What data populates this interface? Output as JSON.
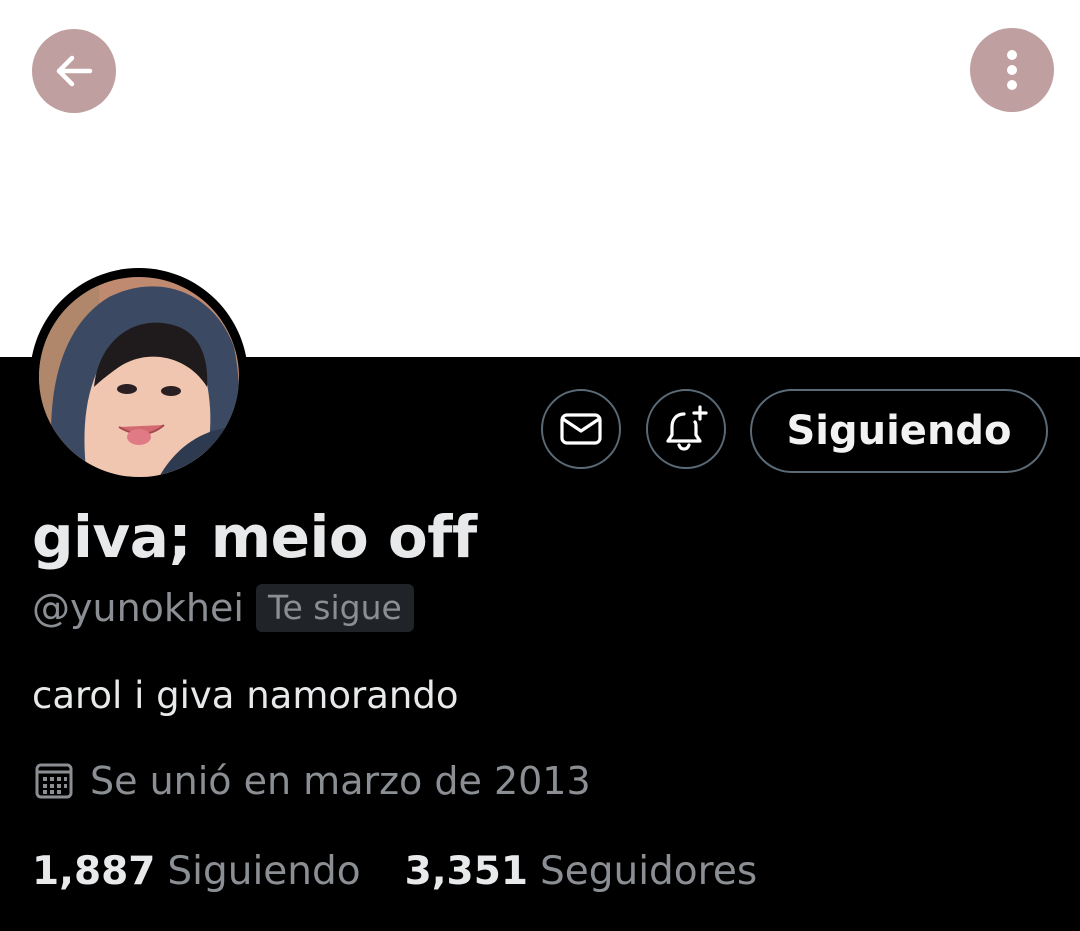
{
  "header": {
    "back_icon": "arrow-left-icon",
    "more_icon": "more-vertical-icon",
    "button_color": "#bf9f9f",
    "banner_color": "#ffffff"
  },
  "profile": {
    "display_name": "giva; meio off",
    "handle": "@yunokhei",
    "follows_you_badge": "Te sigue",
    "bio": "carol i giva namorando",
    "joined": "Se unió en marzo de 2013",
    "joined_icon": "calendar-icon"
  },
  "actions": {
    "message_icon": "envelope-icon",
    "notify_icon": "bell-plus-icon",
    "follow_button_label": "Siguiendo"
  },
  "stats": {
    "following_count": "1,887",
    "following_label": "Siguiendo",
    "followers_count": "3,351",
    "followers_label": "Seguidores"
  },
  "colors": {
    "background": "#000000",
    "primary_text": "#e7e9ea",
    "secondary_text": "#8b8f94",
    "button_border": "#5a6a76"
  }
}
